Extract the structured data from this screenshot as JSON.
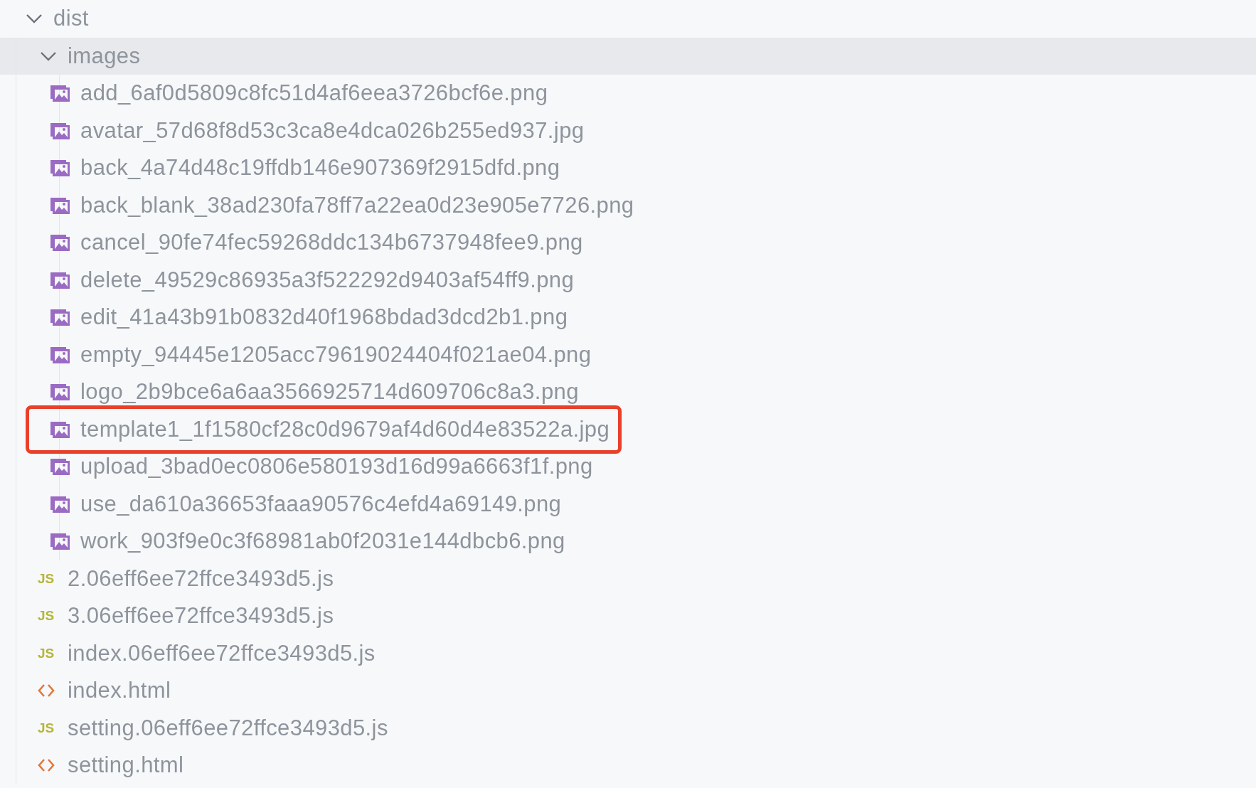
{
  "tree": [
    {
      "name": "dist",
      "kind": "folder",
      "expanded": true,
      "selected": false,
      "children": [
        {
          "name": "images",
          "kind": "folder",
          "expanded": true,
          "selected": true,
          "children": [
            {
              "name": "add_6af0d5809c8fc51d4af6eea3726bcf6e.png",
              "kind": "image",
              "selected": false,
              "marked": false
            },
            {
              "name": "avatar_57d68f8d53c3ca8e4dca026b255ed937.jpg",
              "kind": "image",
              "selected": false,
              "marked": false
            },
            {
              "name": "back_4a74d48c19ffdb146e907369f2915dfd.png",
              "kind": "image",
              "selected": false,
              "marked": false
            },
            {
              "name": "back_blank_38ad230fa78ff7a22ea0d23e905e7726.png",
              "kind": "image",
              "selected": false,
              "marked": false
            },
            {
              "name": "cancel_90fe74fec59268ddc134b6737948fee9.png",
              "kind": "image",
              "selected": false,
              "marked": false
            },
            {
              "name": "delete_49529c86935a3f522292d9403af54ff9.png",
              "kind": "image",
              "selected": false,
              "marked": false
            },
            {
              "name": "edit_41a43b91b0832d40f1968bdad3dcd2b1.png",
              "kind": "image",
              "selected": false,
              "marked": false
            },
            {
              "name": "empty_94445e1205acc79619024404f021ae04.png",
              "kind": "image",
              "selected": false,
              "marked": false
            },
            {
              "name": "logo_2b9bce6a6aa3566925714d609706c8a3.png",
              "kind": "image",
              "selected": false,
              "marked": false
            },
            {
              "name": "template1_1f1580cf28c0d9679af4d60d4e83522a.jpg",
              "kind": "image",
              "selected": false,
              "marked": true
            },
            {
              "name": "upload_3bad0ec0806e580193d16d99a6663f1f.png",
              "kind": "image",
              "selected": false,
              "marked": false
            },
            {
              "name": "use_da610a36653faaa90576c4efd4a69149.png",
              "kind": "image",
              "selected": false,
              "marked": false
            },
            {
              "name": "work_903f9e0c3f68981ab0f2031e144dbcb6.png",
              "kind": "image",
              "selected": false,
              "marked": false
            }
          ]
        },
        {
          "name": "2.06eff6ee72ffce3493d5.js",
          "kind": "js",
          "icon_text": "JS",
          "selected": false,
          "marked": false
        },
        {
          "name": "3.06eff6ee72ffce3493d5.js",
          "kind": "js",
          "icon_text": "JS",
          "selected": false,
          "marked": false
        },
        {
          "name": "index.06eff6ee72ffce3493d5.js",
          "kind": "js",
          "icon_text": "JS",
          "selected": false,
          "marked": false
        },
        {
          "name": "index.html",
          "kind": "html",
          "selected": false,
          "marked": false
        },
        {
          "name": "setting.06eff6ee72ffce3493d5.js",
          "kind": "js",
          "icon_text": "JS",
          "selected": false,
          "marked": false
        },
        {
          "name": "setting.html",
          "kind": "html",
          "selected": false,
          "marked": false
        }
      ]
    }
  ]
}
